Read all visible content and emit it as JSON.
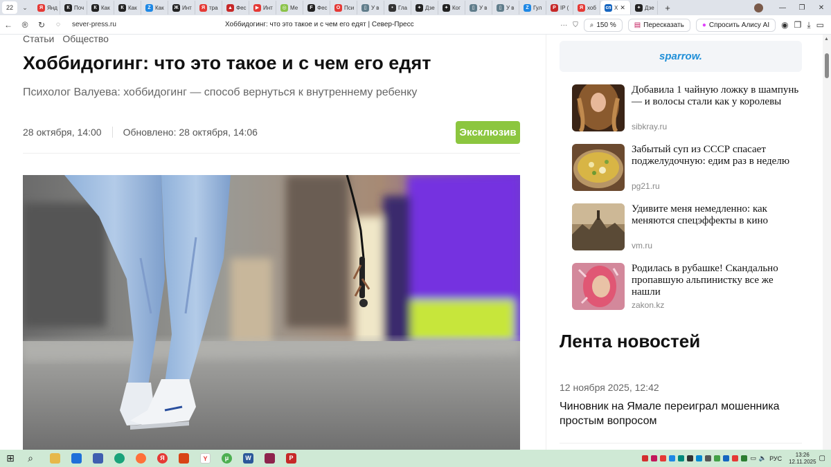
{
  "browser": {
    "tab_count": "22",
    "tabs": [
      {
        "label": "Янд",
        "color": "#e53935",
        "glyph": "Я"
      },
      {
        "label": "Поч",
        "color": "#222222",
        "glyph": "К"
      },
      {
        "label": "Как",
        "color": "#222222",
        "glyph": "К"
      },
      {
        "label": "Как",
        "color": "#222222",
        "glyph": "К"
      },
      {
        "label": "Как",
        "color": "#1e88e5",
        "glyph": "Z"
      },
      {
        "label": "Инт",
        "color": "#222222",
        "glyph": "Ж"
      },
      {
        "label": "тра",
        "color": "#e53935",
        "glyph": "Я"
      },
      {
        "label": "Фес",
        "color": "#c62828",
        "glyph": "▲"
      },
      {
        "label": "Инт",
        "color": "#e53935",
        "glyph": "▶"
      },
      {
        "label": "Ме",
        "color": "#8bc34a",
        "glyph": "◎"
      },
      {
        "label": "Фес",
        "color": "#222222",
        "glyph": "F"
      },
      {
        "label": "Пси",
        "color": "#e53935",
        "glyph": "O"
      },
      {
        "label": "У в",
        "color": "#607d8b",
        "glyph": "▯"
      },
      {
        "label": "Гла",
        "color": "#333333",
        "glyph": "•"
      },
      {
        "label": "Дзе",
        "color": "#222222",
        "glyph": "✦"
      },
      {
        "label": "Ког",
        "color": "#222222",
        "glyph": "✦"
      },
      {
        "label": "У в",
        "color": "#607d8b",
        "glyph": "▯"
      },
      {
        "label": "У в",
        "color": "#607d8b",
        "glyph": "▯"
      },
      {
        "label": "Гул",
        "color": "#1e88e5",
        "glyph": "Z"
      },
      {
        "label": "IP (",
        "color": "#c62828",
        "glyph": "P"
      },
      {
        "label": "хоб",
        "color": "#e53935",
        "glyph": "Я"
      },
      {
        "label": "Х",
        "color": "#1565c0",
        "glyph": "сп",
        "active": true
      },
      {
        "label": "Дзе",
        "color": "#222222",
        "glyph": "✦"
      }
    ],
    "new_tab": "+",
    "window_controls": {
      "minimize": "—",
      "restore": "❐",
      "close": "✕"
    },
    "url_domain": "sever-press.ru",
    "page_title": "Хоббидогинг: что это такое и с чем его едят | Север-Пресс",
    "zoom": "150 %",
    "retell_label": "Пересказать",
    "alice_label": "Спросить Алису AI"
  },
  "article": {
    "breadcrumbs": [
      "Статьи",
      "Общество"
    ],
    "title": "Хоббидогинг: что это такое и с чем его едят",
    "subtitle": "Психолог Валуева: хоббидогинг — способ вернуться к внутреннему ребенку",
    "published": "28 октября, 14:00",
    "updated": "Обновлено: 28 октября, 14:06",
    "badge": "Эксклюзив"
  },
  "sidebar": {
    "ad_logo": "sparrow.",
    "teasers": [
      {
        "headline": "Добавила 1 чайную ложку в шампунь — и волосы стали как у королевы",
        "source": "sibkray.ru"
      },
      {
        "headline": "Забытый суп из СССР спасает поджелудочную: едим раз в неделю",
        "source": "pg21.ru"
      },
      {
        "headline": "Удивите меня немедленно: как меняются спецэффекты в кино",
        "source": "vm.ru"
      },
      {
        "headline": "Родилась в рубашке! Скандально пропавшую альпинистку все же нашли",
        "source": "zakon.kz"
      }
    ],
    "feed_title": "Лента новостей",
    "feed_date": "12 ноября 2025, 12:42",
    "feed_headline": "Чиновник на Ямале переиграл мошенника простым вопросом"
  },
  "taskbar": {
    "lang": "РУС",
    "time": "13:26",
    "date": "12.11.2025"
  },
  "colors": {
    "badge": "#8cc63f",
    "taskbar": "#cfe9d5",
    "ad_logo": "#1f8fd8"
  }
}
